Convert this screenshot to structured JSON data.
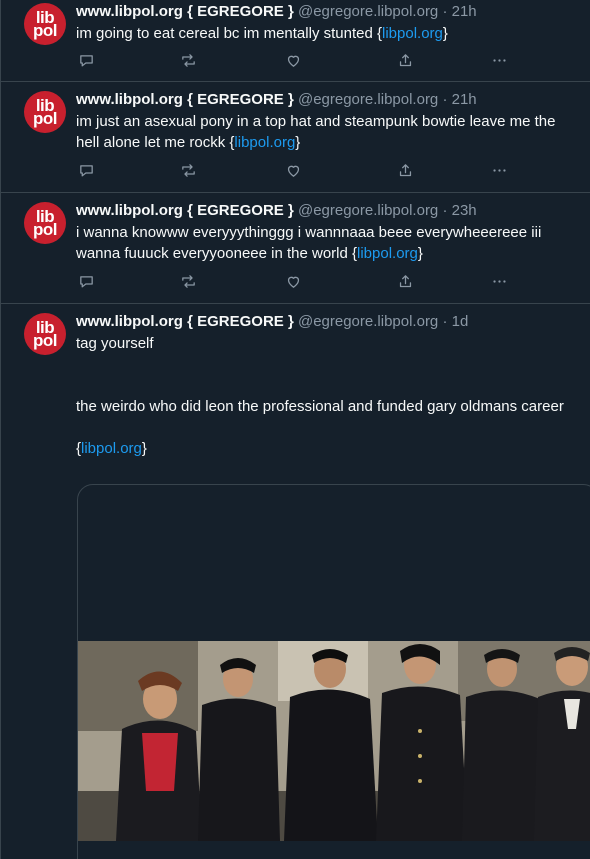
{
  "posts": [
    {
      "avatar": {
        "line1": "lib",
        "line2": "pol"
      },
      "display_name": "www.libpol.org { EGREGORE }",
      "handle": "@egregore.libpol.org",
      "separator": "·",
      "time": "21h",
      "text_before": "im going to eat cereal bc im mentally stunted {",
      "link": "libpol.org",
      "text_after": "}"
    },
    {
      "avatar": {
        "line1": "lib",
        "line2": "pol"
      },
      "display_name": "www.libpol.org { EGREGORE }",
      "handle": "@egregore.libpol.org",
      "separator": "·",
      "time": "21h",
      "text_before": "im just an asexual pony in a top hat and steampunk bowtie leave me the hell alone let me rockk {",
      "link": "libpol.org",
      "text_after": "}"
    },
    {
      "avatar": {
        "line1": "lib",
        "line2": "pol"
      },
      "display_name": "www.libpol.org { EGREGORE }",
      "handle": "@egregore.libpol.org",
      "separator": "·",
      "time": "23h",
      "text_before": "i wanna knowww everyyythinggg i wannnaaa beee everywheeereee iii wanna fuuuck everyyooneee in the world {",
      "link": "libpol.org",
      "text_after": "}"
    },
    {
      "avatar": {
        "line1": "lib",
        "line2": "pol"
      },
      "display_name": "www.libpol.org { EGREGORE }",
      "handle": "@egregore.libpol.org",
      "separator": "·",
      "time": "1d",
      "para1": "tag yourself",
      "para2": "the weirdo who did leon the professional and funded gary oldmans career",
      "link_open": "{",
      "link": "libpol.org",
      "link_close": "}"
    }
  ],
  "colors": {
    "background": "#15202b",
    "border": "#38444d",
    "text": "#f7f9f9",
    "muted": "#8b98a5",
    "link": "#1d9bf0",
    "avatar": "#c8202e"
  },
  "icons": [
    "reply-icon",
    "repost-icon",
    "like-icon",
    "share-icon",
    "more-icon"
  ]
}
